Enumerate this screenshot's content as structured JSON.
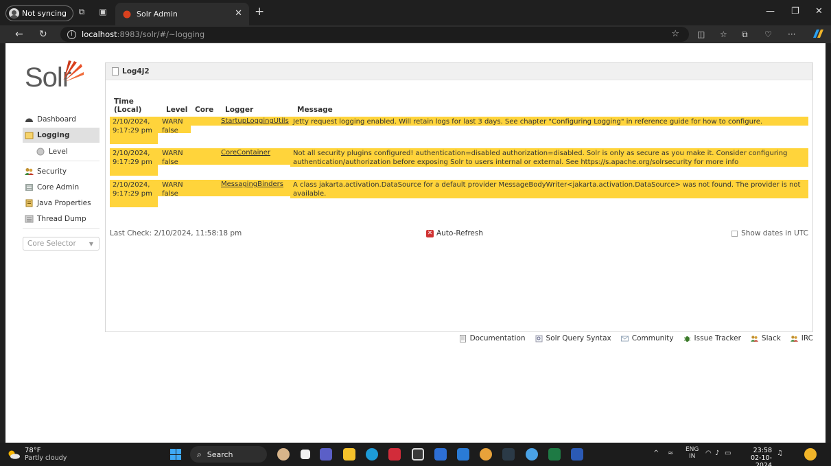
{
  "browser": {
    "profile_label": "Not syncing",
    "tab_title": "Solr Admin",
    "url_host": "localhost",
    "url_path": ":8983/solr/#/~logging"
  },
  "logo": {
    "text": "Solr"
  },
  "sidebar": {
    "items": [
      {
        "label": "Dashboard"
      },
      {
        "label": "Logging"
      },
      {
        "label": "Level"
      },
      {
        "label": "Security"
      },
      {
        "label": "Core Admin"
      },
      {
        "label": "Java Properties"
      },
      {
        "label": "Thread Dump"
      }
    ],
    "core_selector": "Core Selector"
  },
  "breadcrumb": "Log4j2",
  "table": {
    "headers": {
      "time": "Time (Local)",
      "level": "Level",
      "core": "Core",
      "logger": "Logger",
      "message": "Message"
    },
    "rows": [
      {
        "time": "2/10/2024, 9:17:29 pm",
        "level": "WARN",
        "flag": "false",
        "core": "",
        "logger": "StartupLoggingUtils",
        "message": "Jetty request logging enabled. Will retain logs for last 3 days. See chapter \"Configuring Logging\" in reference guide for how to configure."
      },
      {
        "time": "2/10/2024, 9:17:29 pm",
        "level": "WARN",
        "flag": "false",
        "core": "",
        "logger": "CoreContainer",
        "message": "Not all security plugins configured! authentication=disabled authorization=disabled. Solr is only as secure as you make it. Consider configuring authentication/authorization before exposing Solr to users internal or external. See https://s.apache.org/solrsecurity for more info"
      },
      {
        "time": "2/10/2024, 9:17:29 pm",
        "level": "WARN",
        "flag": "false",
        "core": "",
        "logger": "MessagingBinders",
        "message": "A class jakarta.activation.DataSource for a default provider MessageBodyWriter<jakarta.activation.DataSource> was not found. The provider is not available."
      }
    ]
  },
  "status": {
    "last_check": "Last Check: 2/10/2024, 11:58:18 pm",
    "auto_refresh": "Auto-Refresh",
    "show_utc": "Show dates in UTC"
  },
  "footer_links": [
    "Documentation",
    "Solr Query Syntax",
    "Community",
    "Issue Tracker",
    "Slack",
    "IRC"
  ],
  "taskbar": {
    "weather_temp": "78°F",
    "weather_desc": "Partly cloudy",
    "search_label": "Search",
    "lang_top": "ENG",
    "lang_bottom": "IN",
    "time": "23:58",
    "date": "02-10-2024"
  },
  "colors": {
    "log_highlight": "#ffd43b",
    "page_bg": "#ffffff",
    "chrome_bg": "#1f1f1f"
  }
}
